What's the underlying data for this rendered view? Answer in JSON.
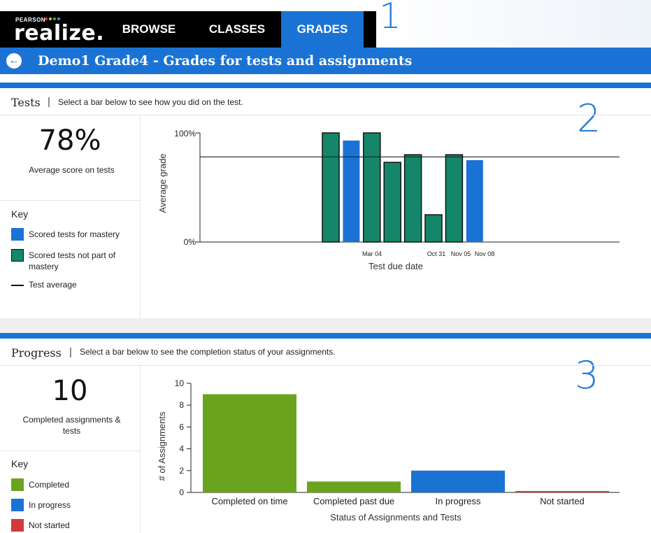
{
  "nav": {
    "logo_small": "PEARSON",
    "logo_word": "realize.",
    "tabs": [
      {
        "label": "BROWSE",
        "active": false
      },
      {
        "label": "CLASSES",
        "active": false
      },
      {
        "label": "GRADES",
        "active": true
      }
    ]
  },
  "annotations": [
    "1",
    "2",
    "3"
  ],
  "page": {
    "title": "Demo1 Grade4 - Grades for tests and assignments"
  },
  "tests": {
    "heading": "Tests",
    "separator": "|",
    "description": "Select a bar below to see how you did on the test.",
    "average_value": "78%",
    "average_label": "Average score on tests",
    "key_heading": "Key",
    "key": [
      {
        "label": "Scored tests for mastery",
        "color": "#1a73d4"
      },
      {
        "label": "Scored tests not part of mastery",
        "color": "#15866a"
      },
      {
        "label": "Test average",
        "color": "#111111"
      }
    ]
  },
  "progress": {
    "heading": "Progress",
    "separator": "|",
    "description": "Select a bar below to see the completion status of your assignments.",
    "completed_value": "10",
    "completed_label": "Completed assignments & tests",
    "key_heading": "Key",
    "key": [
      {
        "label": "Completed",
        "color": "#6aa41e"
      },
      {
        "label": "In progress",
        "color": "#1a73d4"
      },
      {
        "label": "Not started",
        "color": "#d23a3a"
      }
    ]
  },
  "chart_data": [
    {
      "type": "bar",
      "ylabel": "Average grade",
      "xlabel": "Test due date",
      "ylim": [
        0,
        100
      ],
      "y_ticks": [
        "100%",
        "0%"
      ],
      "x_tick_labels": [
        "Mar 04",
        "Oct 31",
        "Nov 05",
        "Nov 08"
      ],
      "average_line": 78,
      "grid": false,
      "values": [
        100,
        93,
        100,
        73,
        80,
        25,
        80,
        75
      ],
      "bar_kinds": [
        "not-mastery",
        "mastery",
        "not-mastery",
        "not-mastery",
        "not-mastery",
        "not-mastery",
        "not-mastery",
        "mastery"
      ],
      "colors": {
        "mastery": "#1a73d4",
        "not-mastery": "#15866a"
      }
    },
    {
      "type": "bar",
      "ylabel": "# of Assignments",
      "xlabel": "Status of Assignments and Tests",
      "ylim": [
        0,
        10
      ],
      "y_ticks": [
        "0",
        "2",
        "4",
        "6",
        "8",
        "10"
      ],
      "categories": [
        "Completed on time",
        "Completed past due",
        "In progress",
        "Not started"
      ],
      "values": [
        9,
        1,
        2,
        0
      ],
      "colors": [
        "#6aa41e",
        "#6aa41e",
        "#1a73d4",
        "#d23a3a"
      ],
      "grid": false
    }
  ]
}
